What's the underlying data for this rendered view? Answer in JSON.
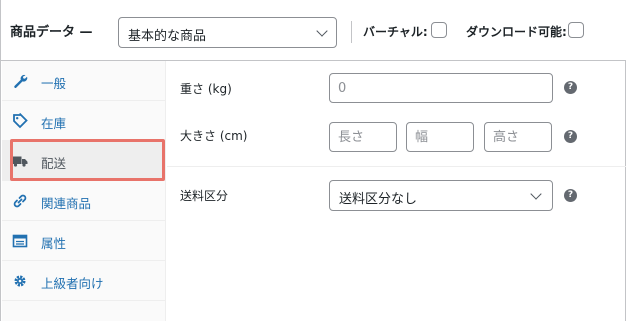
{
  "header": {
    "title": "商品データ —",
    "product_type": "基本的な商品",
    "virtual_label": "バーチャル:",
    "downloadable_label": "ダウンロード可能:"
  },
  "tabs": [
    {
      "label": "一般",
      "icon": "wrench-icon"
    },
    {
      "label": "在庫",
      "icon": "tag-icon"
    },
    {
      "label": "配送",
      "icon": "truck-icon",
      "active": true
    },
    {
      "label": "関連商品",
      "icon": "link-icon"
    },
    {
      "label": "属性",
      "icon": "table-icon"
    },
    {
      "label": "上級者向け",
      "icon": "gear-icon"
    }
  ],
  "shipping": {
    "weight_label": "重さ (kg)",
    "weight_placeholder": "0",
    "dimensions_label": "大きさ (cm)",
    "length_placeholder": "長さ",
    "width_placeholder": "幅",
    "height_placeholder": "高さ",
    "shipping_class_label": "送料区分",
    "shipping_class_value": "送料区分なし"
  },
  "colors": {
    "link": "#2271b1",
    "highlight": "#e8736a"
  }
}
